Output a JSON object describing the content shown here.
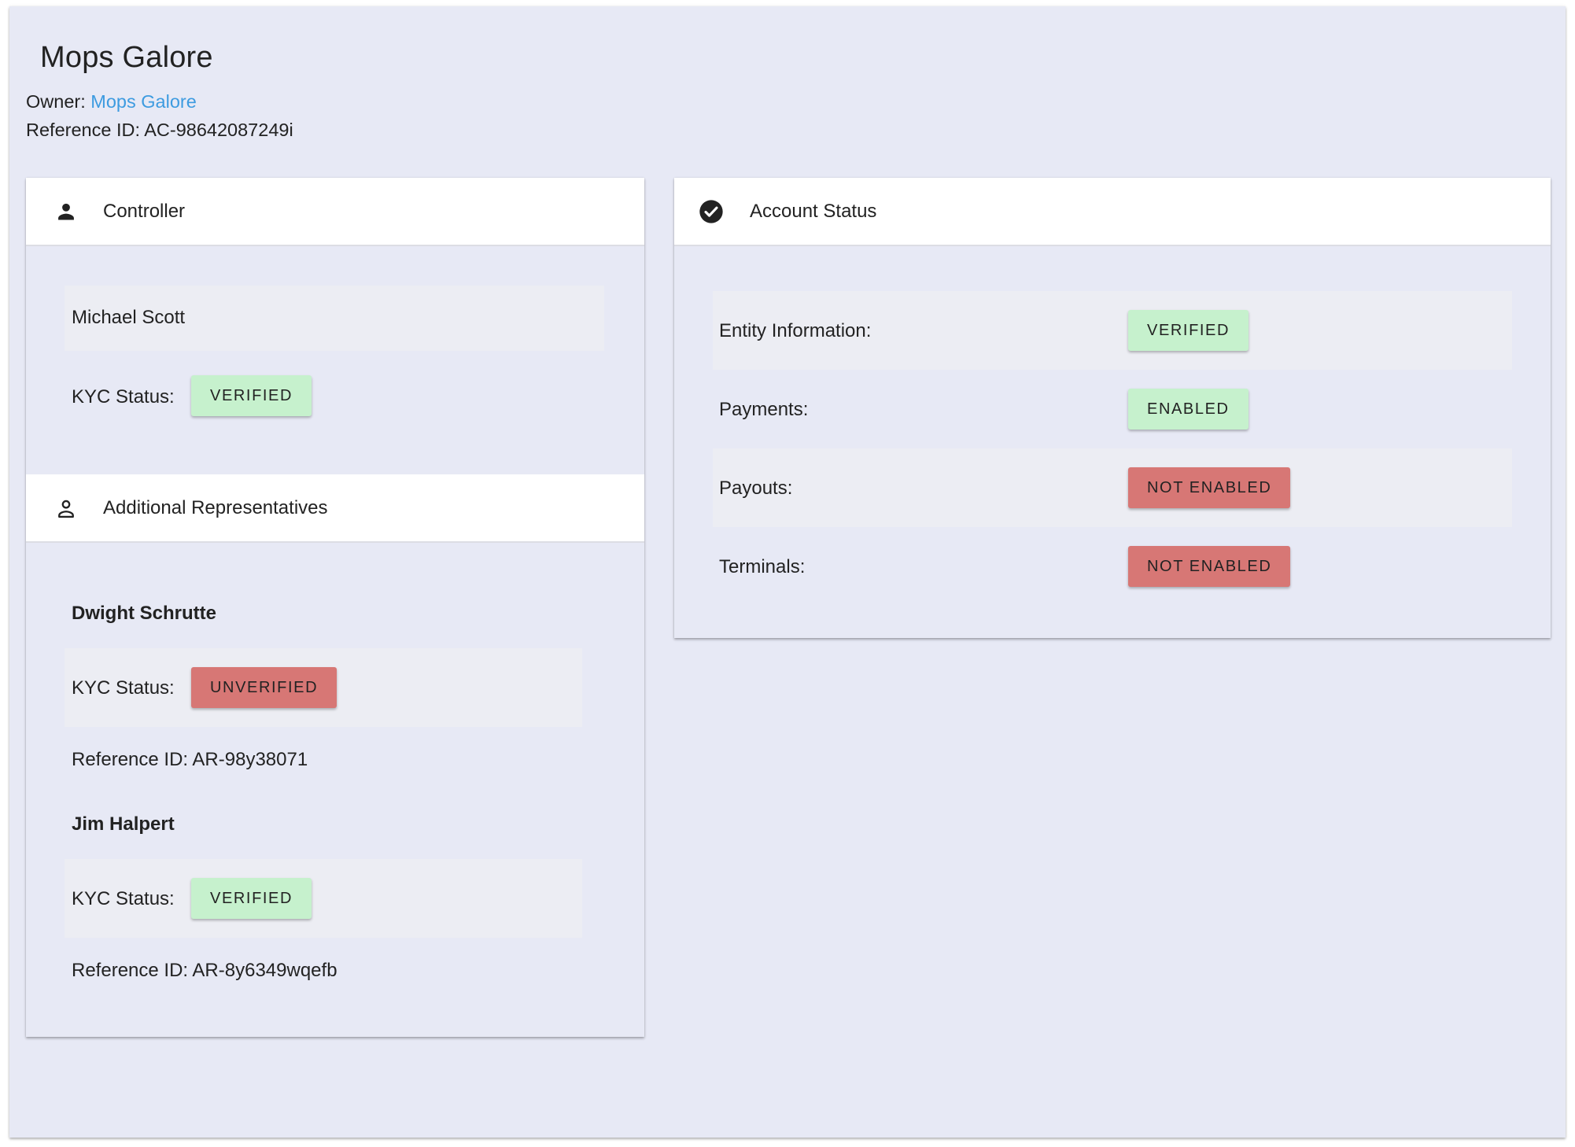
{
  "header": {
    "title": "Mops Galore",
    "owner_label": "Owner:",
    "owner_name": "Mops Galore",
    "reference_label": "Reference ID:",
    "reference_id": "AC-98642087249i"
  },
  "controller": {
    "section_title": "Controller",
    "icon": "person-icon",
    "name": "Michael Scott",
    "kyc_label": "KYC Status:",
    "kyc_status": "VERIFIED",
    "kyc_status_color": "#c6f1cd"
  },
  "additional_representatives": {
    "section_title": "Additional Representatives",
    "icon": "person-outline-icon",
    "items": [
      {
        "name": "Dwight Schrutte",
        "kyc_label": "KYC Status:",
        "kyc_status": "UNVERIFIED",
        "kyc_status_color": "#d77775",
        "reference_label": "Reference ID:",
        "reference_id": "AR-98y38071"
      },
      {
        "name": "Jim Halpert",
        "kyc_label": "KYC Status:",
        "kyc_status": "VERIFIED",
        "kyc_status_color": "#c6f1cd",
        "reference_label": "Reference ID:",
        "reference_id": "AR-8y6349wqefb"
      }
    ]
  },
  "account_status": {
    "section_title": "Account Status",
    "icon": "check-circle-icon",
    "rows": [
      {
        "label": "Entity Information:",
        "status": "VERIFIED",
        "status_color": "#c6f1cd"
      },
      {
        "label": "Payments:",
        "status": "ENABLED",
        "status_color": "#c6f1cd"
      },
      {
        "label": "Payouts:",
        "status": "NOT ENABLED",
        "status_color": "#d77775"
      },
      {
        "label": "Terminals:",
        "status": "NOT ENABLED",
        "status_color": "#d77775"
      }
    ]
  },
  "colors": {
    "page_background": "#e7e9f5",
    "link": "#3d9be0",
    "status_positive": "#c6f1cd",
    "status_negative": "#d77775"
  }
}
